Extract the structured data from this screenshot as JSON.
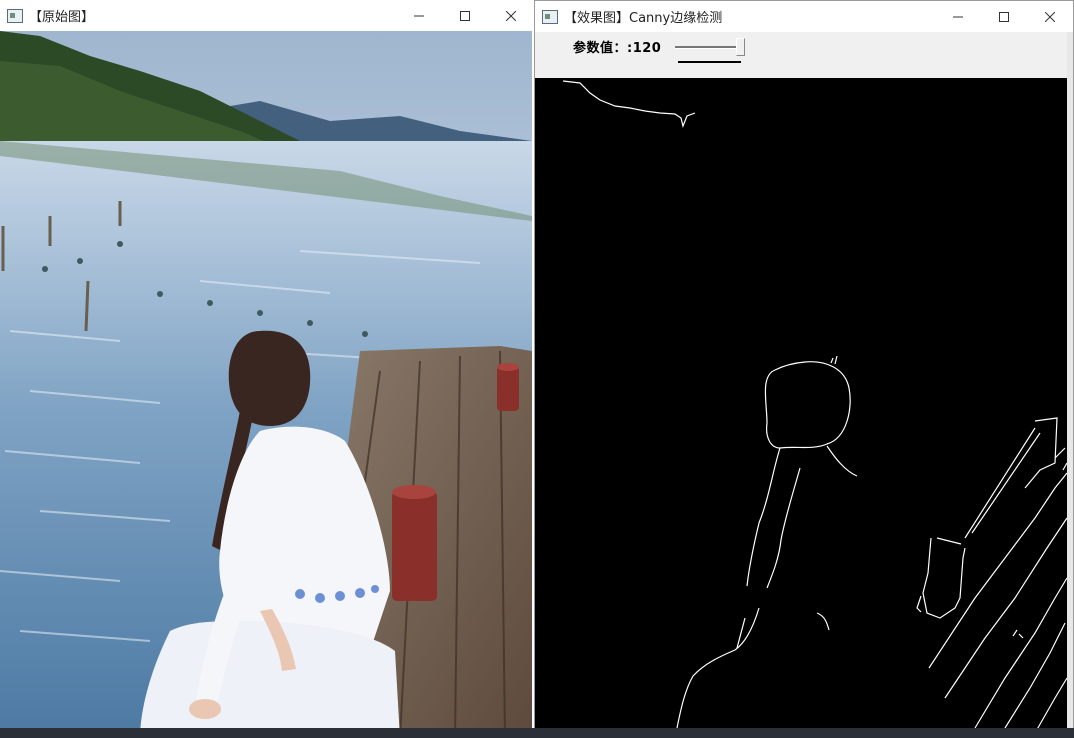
{
  "window_original": {
    "title": "【原始图】",
    "controls": {
      "minimize": "minimize-icon",
      "maximize": "maximize-icon",
      "close": "close-icon"
    }
  },
  "window_effect": {
    "title": "【效果图】Canny边缘检测",
    "trackbar": {
      "label": "参数值：",
      "value": "120",
      "value_fraction": 0.96
    },
    "controls": {
      "minimize": "minimize-icon",
      "maximize": "maximize-icon",
      "close": "close-icon"
    }
  },
  "colors": {
    "edge_background": "#000000",
    "edge_lines": "#ffffff",
    "window_chrome": "#ffffff"
  }
}
